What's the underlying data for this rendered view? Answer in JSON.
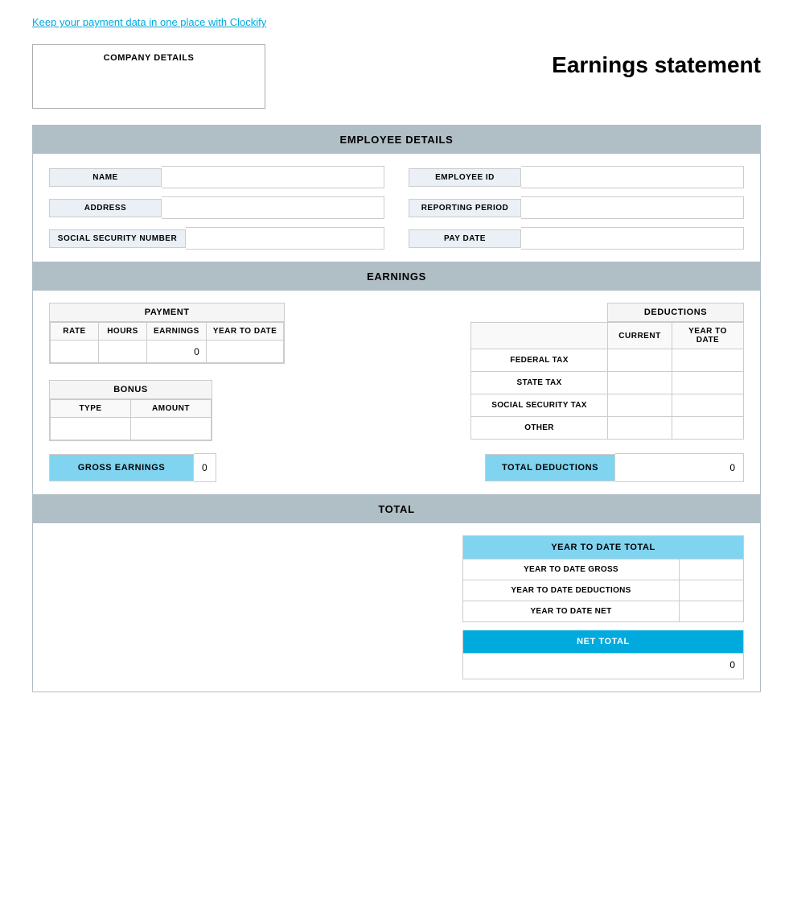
{
  "topLink": {
    "text": "Keep your payment data in one place with Clockify",
    "href": "#"
  },
  "header": {
    "companyLabel": "COMPANY DETAILS",
    "title": "Earnings statement"
  },
  "employeeDetails": {
    "sectionTitle": "EMPLOYEE DETAILS",
    "leftFields": [
      {
        "label": "NAME",
        "value": ""
      },
      {
        "label": "ADDRESS",
        "value": ""
      },
      {
        "label": "SOCIAL SECURITY NUMBER",
        "value": ""
      }
    ],
    "rightFields": [
      {
        "label": "EMPLOYEE ID",
        "value": ""
      },
      {
        "label": "REPORTING PERIOD",
        "value": ""
      },
      {
        "label": "PAY DATE",
        "value": ""
      }
    ]
  },
  "earnings": {
    "sectionTitle": "EARNINGS",
    "payment": {
      "header": "PAYMENT",
      "columns": [
        "RATE",
        "HOURS",
        "EARNINGS",
        "YEAR TO DATE"
      ],
      "rows": [
        {
          "rate": "",
          "hours": "",
          "earnings": "0",
          "ytd": ""
        }
      ]
    },
    "bonus": {
      "header": "BONUS",
      "columns": [
        "TYPE",
        "AMOUNT"
      ],
      "rows": [
        {
          "type": "",
          "amount": ""
        }
      ]
    },
    "deductions": {
      "header": "DEDUCTIONS",
      "columns": [
        "CURRENT",
        "YEAR TO DATE"
      ],
      "rows": [
        {
          "label": "FEDERAL TAX",
          "current": "",
          "ytd": ""
        },
        {
          "label": "STATE TAX",
          "current": "",
          "ytd": ""
        },
        {
          "label": "SOCIAL SECURITY TAX",
          "current": "",
          "ytd": ""
        },
        {
          "label": "OTHER",
          "current": "",
          "ytd": ""
        }
      ]
    },
    "grossEarnings": {
      "label": "GROSS EARNINGS",
      "value": "0"
    },
    "totalDeductions": {
      "label": "TOTAL DEDUCTIONS",
      "value": "0"
    }
  },
  "total": {
    "sectionTitle": "TOTAL",
    "ytdTable": {
      "header": "YEAR TO DATE TOTAL",
      "rows": [
        {
          "label": "YEAR TO DATE GROSS",
          "value": ""
        },
        {
          "label": "YEAR TO DATE DEDUCTIONS",
          "value": ""
        },
        {
          "label": "YEAR TO DATE NET",
          "value": ""
        }
      ]
    },
    "netTotal": {
      "label": "NET TOTAL",
      "value": "0"
    }
  }
}
